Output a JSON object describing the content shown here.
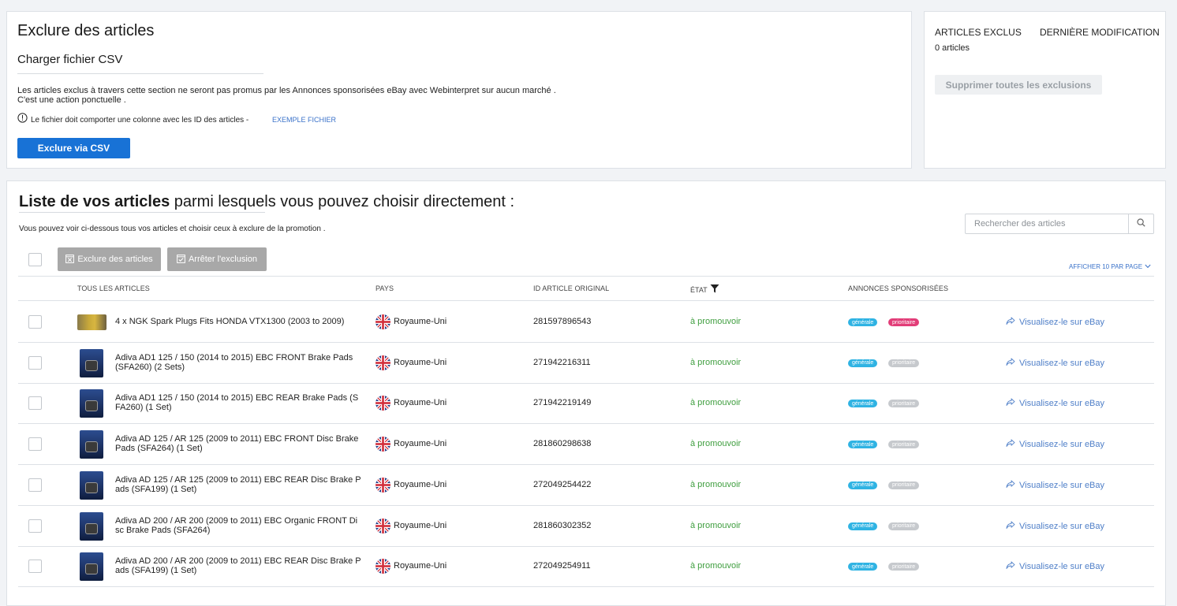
{
  "exclude_card": {
    "title": "Exclure des articles",
    "subtitle": "Charger fichier CSV",
    "description_line1": "Les articles exclus à travers cette section ne seront pas promus par les Annonces sponsorisées eBay avec Webinterpret sur aucun marché .",
    "description_line2": "C'est une action ponctuelle .",
    "notice": "Le fichier doit comporter une colonne avec les ID des articles -",
    "example_link": "EXEMPLE FICHIER",
    "button": "Exclure via CSV"
  },
  "stats_card": {
    "excluded_label": "ARTICLES EXCLUS",
    "modified_label": "DERNIÈRE MODIFICATION",
    "excluded_count": "0 articles",
    "delete_all_button": "Supprimer toutes les exclusions"
  },
  "list": {
    "heading_bold": "Liste de vos articles",
    "heading_rest": "parmi lesquels vous pouvez choisir directement :",
    "description": "Vous pouvez voir ci-dessous tous vos articles et choisir ceux à exclure de la promotion .",
    "search_placeholder": "Rechercher des articles",
    "exclude_button": "Exclure des articles",
    "stop_button": "Arrêter l'exclusion",
    "per_page": "AFFICHER 10 PAR PAGE",
    "columns": {
      "all": "TOUS LES ARTICLES",
      "country": "PAYS",
      "id": "ID ARTICLE ORIGINAL",
      "state": "ÉTAT",
      "ads": "ANNONCES SPONSORISÉES"
    },
    "badge_general": "générale",
    "badge_priority": "prioritaire",
    "view_label": "Visualisez-le sur eBay",
    "rows": [
      {
        "title": "4 x NGK Spark Plugs Fits HONDA VTX1300 (2003 to 2009)",
        "country": "Royaume-Uni",
        "id": "281597896543",
        "state": "à promouvoir",
        "priority_active": true
      },
      {
        "title": "Adiva AD1 125 / 150 (2014 to 2015) EBC FRONT Brake Pads (SFA260) (2 Sets)",
        "country": "Royaume-Uni",
        "id": "271942216311",
        "state": "à promouvoir",
        "priority_active": false
      },
      {
        "title": "Adiva AD1 125 / 150 (2014 to 2015) EBC REAR Brake Pads (SFA260) (1 Set)",
        "country": "Royaume-Uni",
        "id": "271942219149",
        "state": "à promouvoir",
        "priority_active": false
      },
      {
        "title": "Adiva AD 125 / AR 125 (2009 to 2011) EBC FRONT Disc Brake Pads (SFA264) (1 Set)",
        "country": "Royaume-Uni",
        "id": "281860298638",
        "state": "à promouvoir",
        "priority_active": false
      },
      {
        "title": "Adiva AD 125 / AR 125 (2009 to 2011) EBC REAR Disc Brake Pads (SFA199) (1 Set)",
        "country": "Royaume-Uni",
        "id": "272049254422",
        "state": "à promouvoir",
        "priority_active": false
      },
      {
        "title": "Adiva AD 200 / AR 200 (2009 to 2011) EBC Organic FRONT Disc Brake Pads (SFA264)",
        "country": "Royaume-Uni",
        "id": "281860302352",
        "state": "à promouvoir",
        "priority_active": false
      },
      {
        "title": "Adiva AD 200 / AR 200 (2009 to 2011) EBC REAR Disc Brake Pads (SFA199) (1 Set)",
        "country": "Royaume-Uni",
        "id": "272049254911",
        "state": "à promouvoir",
        "priority_active": false
      }
    ]
  },
  "colors": {
    "primary": "#1872d6",
    "state_green": "#3f9e3f",
    "badge_general": "#2fb3e3",
    "badge_priority_active": "#e23d78",
    "badge_priority_inactive": "#c6c9cd",
    "link": "#4f7fc8"
  }
}
